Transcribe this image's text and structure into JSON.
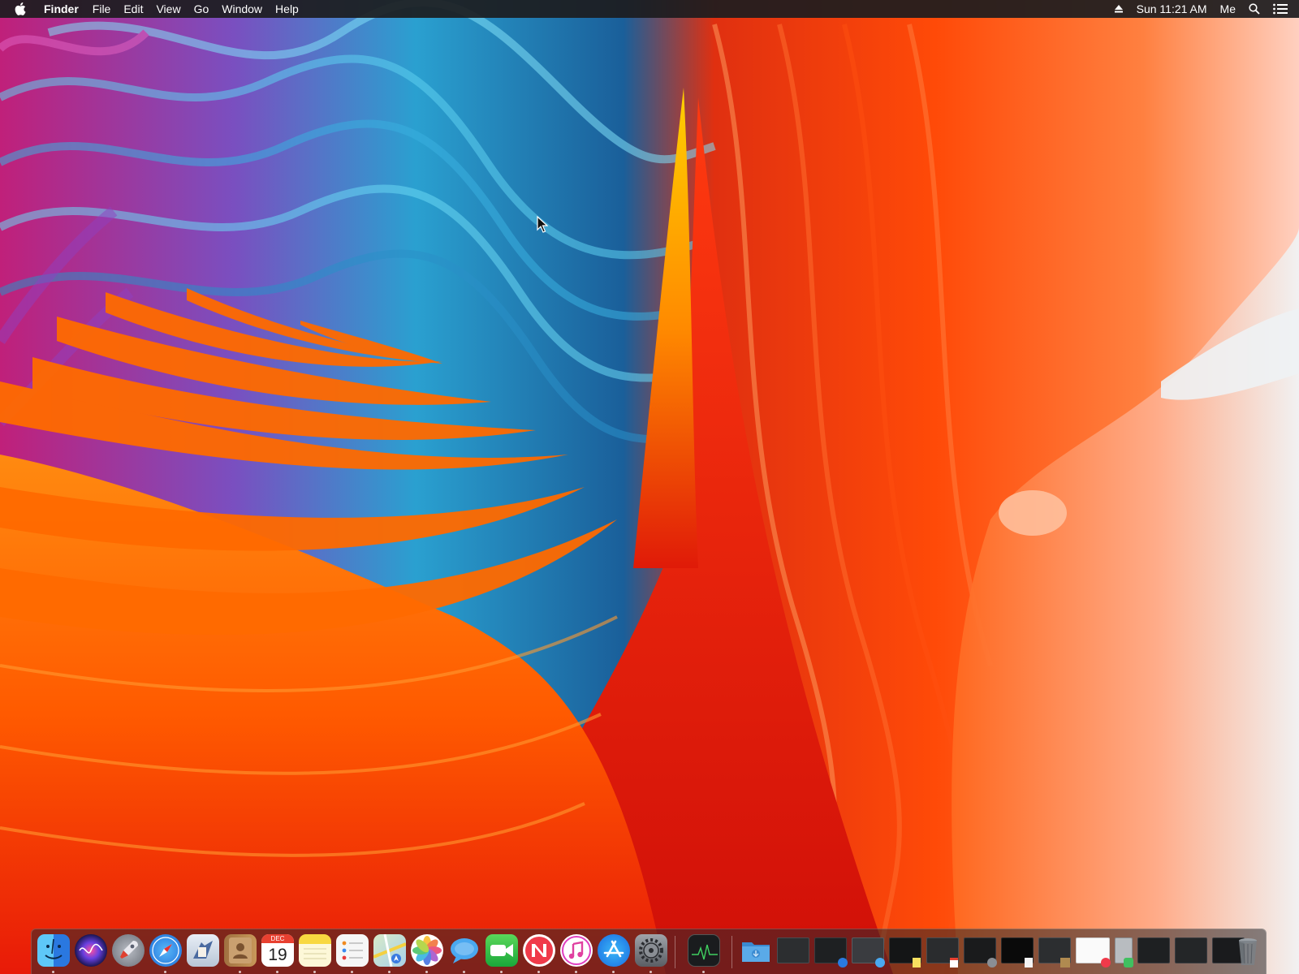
{
  "menubar": {
    "apple_icon": "apple-logo-icon",
    "app_name": "Finder",
    "menus": [
      "File",
      "Edit",
      "View",
      "Go",
      "Window",
      "Help"
    ],
    "status": {
      "eject_icon": "eject-icon",
      "clock": "Sun 11:21 AM",
      "user": "Me",
      "search_icon": "spotlight-search-icon",
      "notifications_icon": "notification-center-icon"
    }
  },
  "desktop": {
    "wallpaper": "abstract orange, red, blue and purple wave wallpaper",
    "colors": {
      "orange": "#ff6a00",
      "red": "#e01a10",
      "blue": "#1f8fc8",
      "magenta": "#c0207a",
      "peach": "#ffb08a"
    }
  },
  "dock": {
    "calendar_month": "DEC",
    "calendar_day": "19",
    "apps": [
      {
        "name": "Finder",
        "icon": "finder-icon",
        "running": true
      },
      {
        "name": "Siri",
        "icon": "siri-icon",
        "running": false
      },
      {
        "name": "Launchpad",
        "icon": "launchpad-icon",
        "running": false
      },
      {
        "name": "Safari",
        "icon": "safari-icon",
        "running": true
      },
      {
        "name": "Mail",
        "icon": "mail-icon",
        "running": false
      },
      {
        "name": "Contacts",
        "icon": "contacts-icon",
        "running": true
      },
      {
        "name": "Calendar",
        "icon": "calendar-icon",
        "running": true
      },
      {
        "name": "Notes",
        "icon": "notes-icon",
        "running": true
      },
      {
        "name": "Reminders",
        "icon": "reminders-icon",
        "running": true
      },
      {
        "name": "Maps",
        "icon": "maps-icon",
        "running": true
      },
      {
        "name": "Photos",
        "icon": "photos-icon",
        "running": true
      },
      {
        "name": "Messages",
        "icon": "messages-icon",
        "running": true
      },
      {
        "name": "FaceTime",
        "icon": "facetime-icon",
        "running": true
      },
      {
        "name": "News",
        "icon": "news-icon",
        "running": true
      },
      {
        "name": "Music",
        "icon": "music-icon",
        "running": true
      },
      {
        "name": "App Store",
        "icon": "app-store-icon",
        "running": true
      },
      {
        "name": "System Preferences",
        "icon": "system-preferences-icon",
        "running": true
      },
      {
        "name": "Activity Monitor",
        "icon": "activity-monitor-icon",
        "running": true
      }
    ],
    "right_items": [
      {
        "name": "Downloads folder",
        "icon": "folder-icon"
      },
      {
        "name": "Minimized window",
        "icon": "window-thumbnail-icon"
      },
      {
        "name": "Minimized window",
        "icon": "window-thumbnail-icon"
      },
      {
        "name": "Minimized window",
        "icon": "window-thumbnail-icon"
      },
      {
        "name": "Minimized window",
        "icon": "window-thumbnail-icon"
      },
      {
        "name": "Minimized window",
        "icon": "window-thumbnail-icon"
      },
      {
        "name": "Minimized window",
        "icon": "window-thumbnail-icon"
      },
      {
        "name": "Minimized window",
        "icon": "window-thumbnail-icon"
      },
      {
        "name": "Minimized window",
        "icon": "window-thumbnail-icon"
      },
      {
        "name": "Minimized window",
        "icon": "window-thumbnail-icon"
      },
      {
        "name": "Minimized window",
        "icon": "window-thumbnail-icon"
      },
      {
        "name": "Minimized window",
        "icon": "window-thumbnail-icon"
      },
      {
        "name": "Minimized window",
        "icon": "window-thumbnail-icon"
      },
      {
        "name": "Trash",
        "icon": "trash-icon"
      }
    ]
  }
}
